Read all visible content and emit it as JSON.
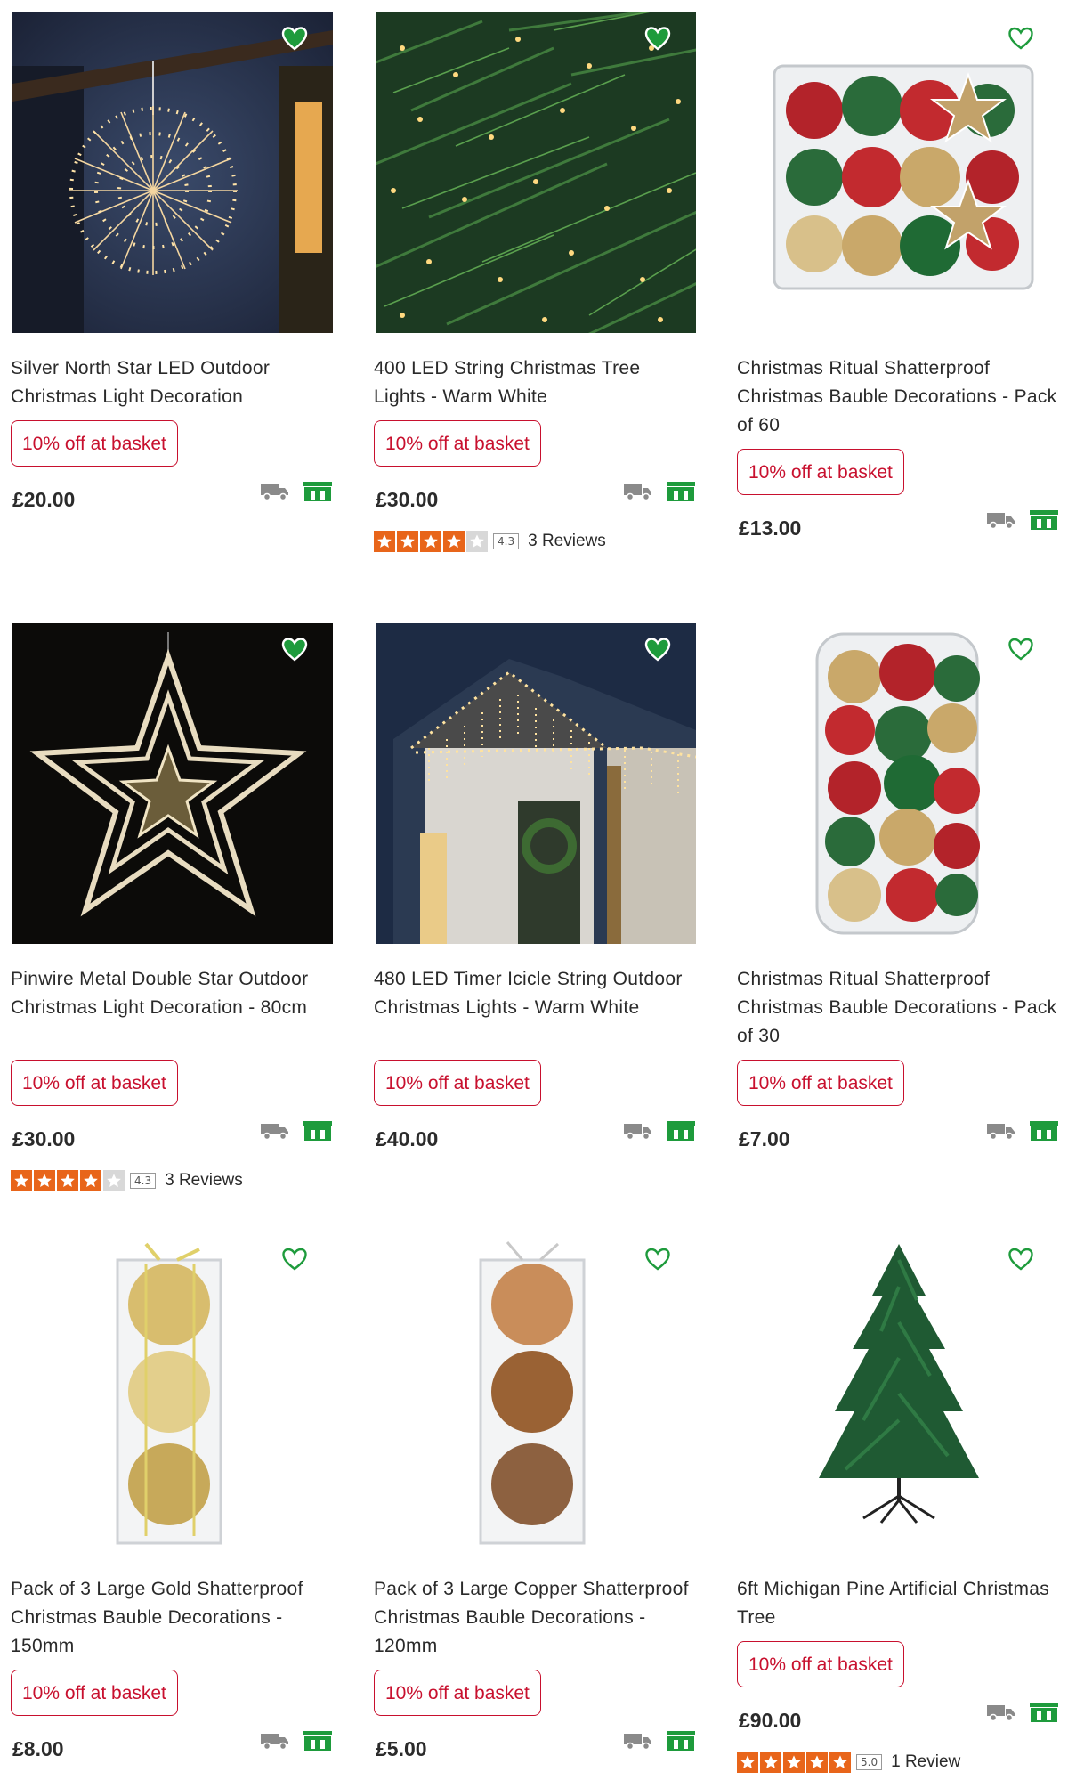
{
  "products": [
    {
      "title": "Silver North Star LED Outdoor Christmas Light Decoration",
      "promo": "10% off at basket",
      "price": "£20.00",
      "image_icon": "starburst-light-image",
      "heart": "filled"
    },
    {
      "title": "400 LED String Christmas Tree Lights - Warm White",
      "promo": "10% off at basket",
      "price": "£30.00",
      "image_icon": "tree-lights-image",
      "heart": "filled",
      "rating": {
        "score": "4.3",
        "reviews": "3 Reviews",
        "stars": 4.3
      }
    },
    {
      "title": "Christmas Ritual Shatterproof Christmas Bauble Decorations - Pack of 60",
      "promo": "10% off at basket",
      "price": "£13.00",
      "image_icon": "bauble-box-image",
      "heart": "outline"
    },
    {
      "title": "Pinwire Metal Double Star Outdoor Christmas Light Decoration - 80cm",
      "promo": "10% off at basket",
      "price": "£30.00",
      "image_icon": "double-star-image",
      "heart": "filled",
      "rating": {
        "score": "4.3",
        "reviews": "3 Reviews",
        "stars": 4.3
      }
    },
    {
      "title": "480 LED Timer Icicle String Outdoor Christmas Lights - Warm White",
      "promo": "10% off at basket",
      "price": "£40.00",
      "image_icon": "icicle-house-image",
      "heart": "filled"
    },
    {
      "title": "Christmas Ritual Shatterproof Christmas Bauble Decorations - Pack of 30",
      "promo": "10% off at basket",
      "price": "£7.00",
      "image_icon": "bauble-tube-image",
      "heart": "outline"
    },
    {
      "title": "Pack of 3 Large Gold Shatterproof Christmas Bauble Decorations - 150mm",
      "promo": "10% off at basket",
      "price": "£8.00",
      "image_icon": "gold-baubles-image",
      "heart": "outline"
    },
    {
      "title": "Pack of 3 Large Copper Shatterproof Christmas Bauble Decorations - 120mm",
      "promo": "10% off at basket",
      "price": "£5.00",
      "image_icon": "copper-baubles-image",
      "heart": "outline"
    },
    {
      "title": "6ft Michigan Pine Artificial Christmas Tree",
      "promo": "10% off at basket",
      "price": "£90.00",
      "image_icon": "pine-tree-image",
      "heart": "outline",
      "rating": {
        "score": "5.0",
        "reviews": "1 Review",
        "stars": 5
      }
    }
  ],
  "colors": {
    "promo": "#c8102e",
    "heart": "#1e9b3c",
    "store": "#1e9b3c",
    "star": "#e8651a",
    "truck": "#8a8a8a"
  },
  "icons": {
    "delivery": "truck-icon",
    "collect": "store-icon",
    "wishlist": "heart-icon",
    "rating": "star-icon"
  }
}
